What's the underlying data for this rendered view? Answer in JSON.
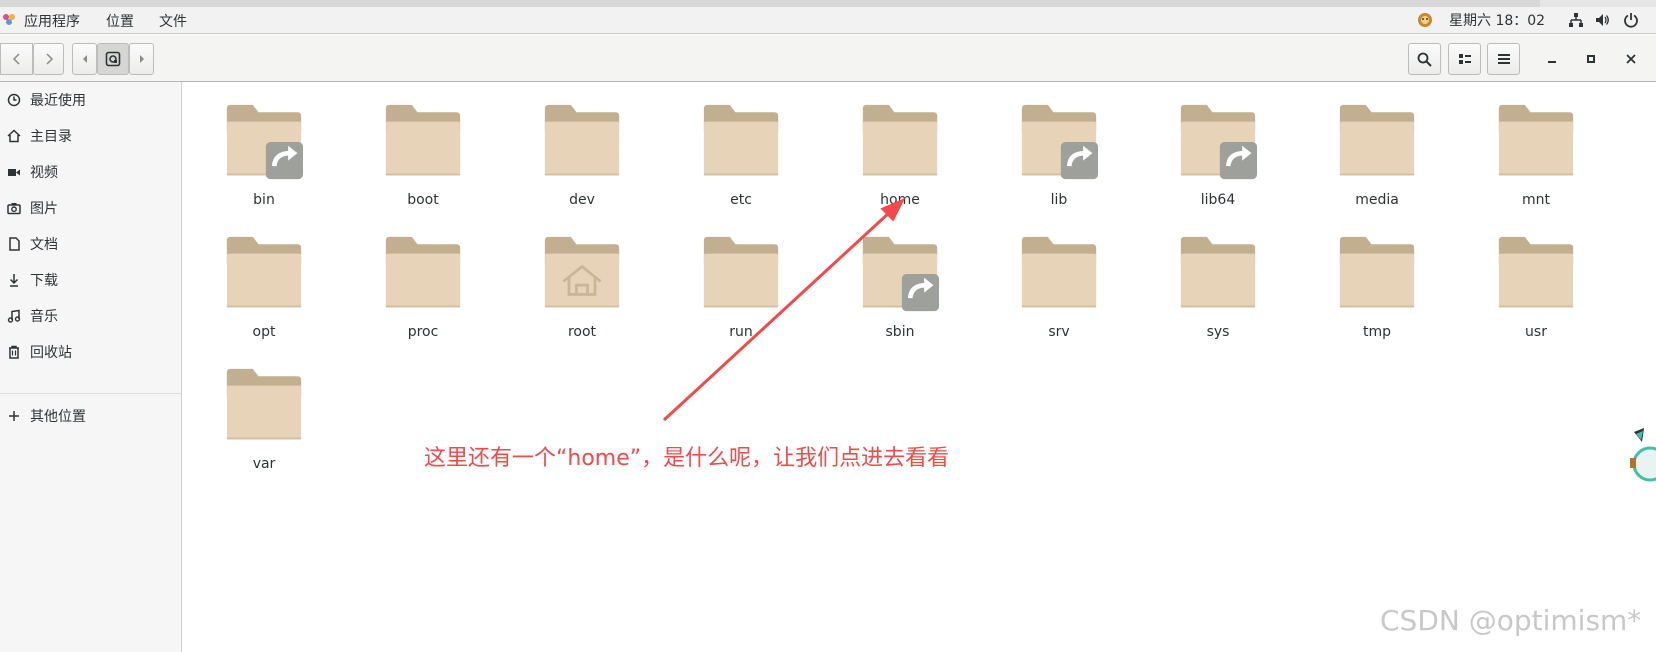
{
  "top_panel": {
    "apps_label": "应用程序",
    "places_label": "位置",
    "files_label": "文件",
    "datetime": "星期六 18：02"
  },
  "sidebar": {
    "items": [
      {
        "label": "最近使用",
        "icon": "recent-icon"
      },
      {
        "label": "主目录",
        "icon": "home-icon"
      },
      {
        "label": "视频",
        "icon": "video-icon"
      },
      {
        "label": "图片",
        "icon": "camera-icon"
      },
      {
        "label": "文档",
        "icon": "document-icon"
      },
      {
        "label": "下载",
        "icon": "download-icon"
      },
      {
        "label": "音乐",
        "icon": "music-icon"
      },
      {
        "label": "回收站",
        "icon": "trash-icon"
      }
    ],
    "other_locations": "其他位置"
  },
  "files": [
    {
      "name": "bin",
      "symlink": true
    },
    {
      "name": "boot"
    },
    {
      "name": "dev"
    },
    {
      "name": "etc"
    },
    {
      "name": "home"
    },
    {
      "name": "lib",
      "symlink": true
    },
    {
      "name": "lib64",
      "symlink": true
    },
    {
      "name": "media"
    },
    {
      "name": "mnt"
    },
    {
      "name": "opt"
    },
    {
      "name": "proc"
    },
    {
      "name": "root",
      "home_emblem": true
    },
    {
      "name": "run"
    },
    {
      "name": "sbin",
      "symlink": true
    },
    {
      "name": "srv"
    },
    {
      "name": "sys"
    },
    {
      "name": "tmp"
    },
    {
      "name": "usr"
    },
    {
      "name": "var"
    }
  ],
  "annotation": {
    "text": "这里还有一个“home”，是什么呢，让我们点进去看看",
    "color": "#f24a4a"
  },
  "watermark": "CSDN @optimism*",
  "colors": {
    "folder_body": "#e7d4b8",
    "folder_tab": "#c2af8f",
    "emblem": "#9ea09c"
  }
}
